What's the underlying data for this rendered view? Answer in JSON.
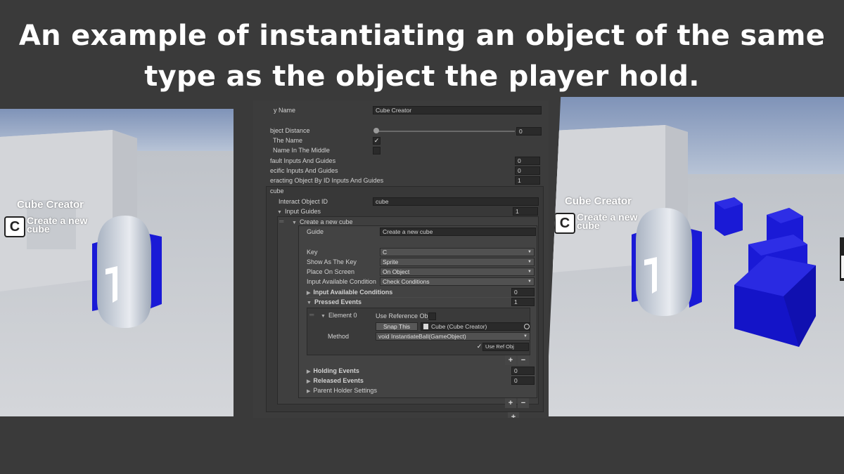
{
  "headline": "An example of instantiating an object of the same type as the object the player hold.",
  "hud": {
    "title": "Cube Creator",
    "key": "C",
    "guide": "Create a new cube"
  },
  "inspector": {
    "display_name_label": "y Name",
    "display_name_value": "Cube Creator",
    "object_distance_label": "bject Distance",
    "object_distance_value": "0",
    "the_name_label": "The Name",
    "name_middle_label": "Name In The Middle",
    "default_inputs_label": "fault Inputs And Guides",
    "default_inputs_value": "0",
    "specific_inputs_label": "ecific Inputs And Guides",
    "specific_inputs_value": "0",
    "by_id_label": "eracting Object By ID Inputs And Guides",
    "by_id_value": "1",
    "cube_header": "cube",
    "interact_id_label": "Interact Object ID",
    "interact_id_value": "cube",
    "input_guides_label": "Input Guides",
    "input_guides_value": "1",
    "create_cube_label": "Create a new cube",
    "guide_label": "Guide",
    "guide_value": "Create a new cube",
    "key_label": "Key",
    "key_value": "C",
    "show_as_key_label": "Show As The Key",
    "show_as_key_value": "Sprite",
    "place_label": "Place On Screen",
    "place_value": "On Object",
    "condition_label": "Input Available Condition",
    "condition_value": "Check Conditions",
    "conditions_label": "Input Available Conditions",
    "conditions_value": "0",
    "pressed_label": "Pressed Events",
    "pressed_value": "1",
    "element_label": "Element 0",
    "use_ref_label": "Use Reference Obje",
    "snap_label": "Snap This",
    "object_ref": "Cube (Cube Creator)",
    "method_label": "Method",
    "method_value": "void InstantiateBall(GameObject)",
    "use_ref_obj_label": "Use Ref Obj",
    "holding_label": "Holding Events",
    "holding_value": "0",
    "released_label": "Released Events",
    "released_value": "0",
    "parent_label": "Parent Holder Settings",
    "plus": "+",
    "minus": "−"
  },
  "colors": {
    "background": "#3a3a3a",
    "sky": "#8fa2c2",
    "ground": "#c9cbd0",
    "cube_blue": "#1a1ad6",
    "inspector_bg": "#3c3c3c"
  }
}
